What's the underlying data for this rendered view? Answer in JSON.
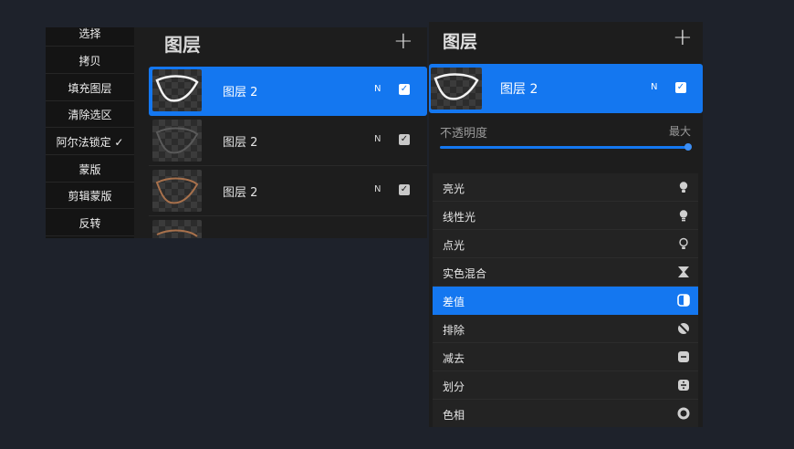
{
  "context_menu": {
    "items": [
      {
        "label": "选择"
      },
      {
        "label": "拷贝"
      },
      {
        "label": "填充图层"
      },
      {
        "label": "清除选区"
      },
      {
        "label": "阿尔法锁定 ✓"
      },
      {
        "label": "蒙版"
      },
      {
        "label": "剪辑蒙版"
      },
      {
        "label": "反转"
      }
    ]
  },
  "layers_left": {
    "title": "图层",
    "add_label": "+",
    "layers": [
      {
        "name": "图层 2",
        "blend": "N",
        "check": "✓",
        "selected": true,
        "stroke": "#f2f2f2"
      },
      {
        "name": "图层 2",
        "blend": "N",
        "check": "✓",
        "selected": false,
        "stroke": "#5a5a5a"
      },
      {
        "name": "图层 2",
        "blend": "N",
        "check": "✓",
        "selected": false,
        "stroke": "#a8714c"
      }
    ]
  },
  "layers_right": {
    "title": "图层",
    "add_label": "+",
    "layer": {
      "name": "图层 2",
      "blend": "N",
      "check": "✓"
    },
    "opacity_label": "不透明度",
    "opacity_max": "最大",
    "opacity_value": 1.0,
    "blend_modes": [
      {
        "label": "亮光",
        "icon": "bulb-icon"
      },
      {
        "label": "线性光",
        "icon": "bulb-icon"
      },
      {
        "label": "点光",
        "icon": "bulb-outline-icon"
      },
      {
        "label": "实色混合",
        "icon": "hourglass-icon"
      },
      {
        "label": "差值",
        "icon": "half-square-icon",
        "active": true
      },
      {
        "label": "排除",
        "icon": "slashed-circle-icon"
      },
      {
        "label": "减去",
        "icon": "minus-box-icon"
      },
      {
        "label": "划分",
        "icon": "divide-box-icon"
      },
      {
        "label": "色相",
        "icon": "ring-icon"
      }
    ]
  },
  "colors": {
    "accent": "#1477f0",
    "background": "#1e222b",
    "panel": "#1d1d1d"
  }
}
